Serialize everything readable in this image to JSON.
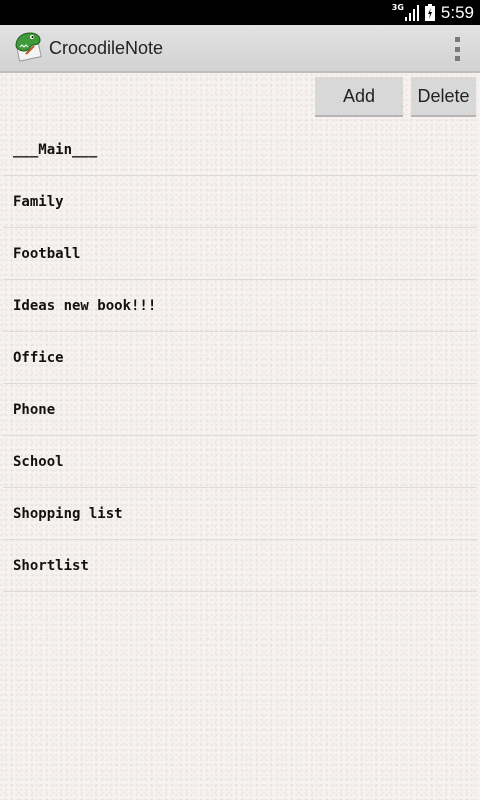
{
  "status_bar": {
    "network_type": "3G",
    "time": "5:59"
  },
  "action_bar": {
    "app_title": "CrocodileNote",
    "logo_icon": "crocodile-logo-icon",
    "overflow_icon": "overflow-menu-icon"
  },
  "toolbar": {
    "add_label": "Add",
    "delete_label": "Delete"
  },
  "notes": [
    "___Main___",
    "Family",
    "Football",
    "Ideas new book!!!",
    "Office",
    "Phone",
    "School",
    "Shopping list",
    "Shortlist"
  ],
  "colors": {
    "status_bar_bg": "#000000",
    "action_bar_bg": "#d8d8d8",
    "page_bg": "#f6f2f0",
    "button_bg": "#d8d8d8",
    "divider": "#dedad8"
  }
}
